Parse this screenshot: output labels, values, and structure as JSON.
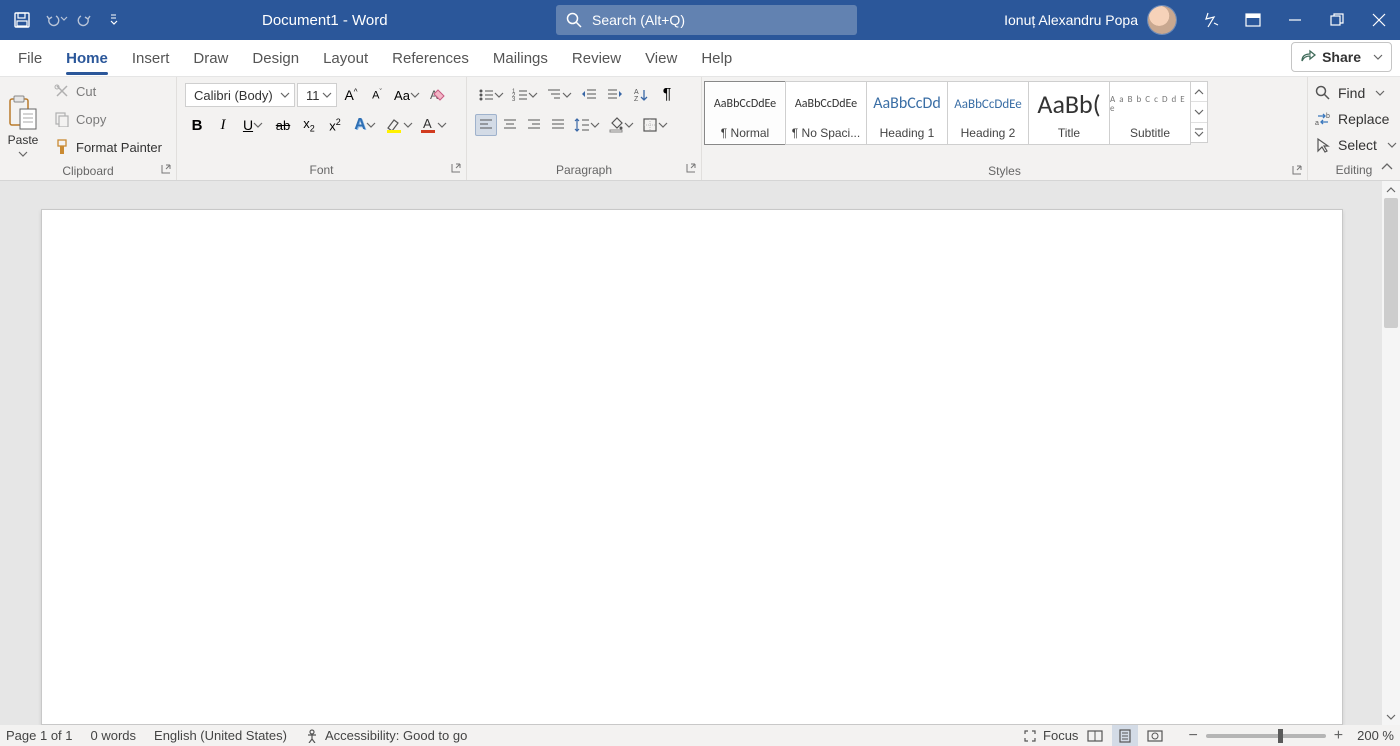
{
  "titlebar": {
    "doc_title": "Document1  -  Word",
    "search_placeholder": "Search (Alt+Q)",
    "user_name": "Ionuț Alexandru Popa"
  },
  "tabs": {
    "items": [
      "File",
      "Home",
      "Insert",
      "Draw",
      "Design",
      "Layout",
      "References",
      "Mailings",
      "Review",
      "View",
      "Help"
    ],
    "active_index": 1,
    "share_label": "Share"
  },
  "ribbon": {
    "clipboard": {
      "paste": "Paste",
      "cut": "Cut",
      "copy": "Copy",
      "format_painter": "Format Painter",
      "group_label": "Clipboard"
    },
    "font": {
      "font_name": "Calibri (Body)",
      "font_size": "11",
      "group_label": "Font"
    },
    "paragraph": {
      "group_label": "Paragraph"
    },
    "styles": {
      "items": [
        {
          "sample": "AaBbCcDdEe",
          "name": "¶ Normal",
          "sample_size": "12px",
          "blue": false
        },
        {
          "sample": "AaBbCcDdEe",
          "name": "¶ No Spaci...",
          "sample_size": "12px",
          "blue": false
        },
        {
          "sample": "AaBbCcDd",
          "name": "Heading 1",
          "sample_size": "16px",
          "blue": true
        },
        {
          "sample": "AaBbCcDdEe",
          "name": "Heading 2",
          "sample_size": "13px",
          "blue": true
        },
        {
          "sample": "AaBb(",
          "name": "Title",
          "sample_size": "28px",
          "blue": false
        },
        {
          "sample": "A a B b C c D d E e",
          "name": "Subtitle",
          "sample_size": "9px",
          "blue": false
        }
      ],
      "group_label": "Styles"
    },
    "editing": {
      "find": "Find",
      "replace": "Replace",
      "select": "Select",
      "group_label": "Editing"
    }
  },
  "statusbar": {
    "page": "Page 1 of 1",
    "words": "0 words",
    "language": "English (United States)",
    "accessibility": "Accessibility: Good to go",
    "focus": "Focus",
    "zoom": "200 %"
  }
}
